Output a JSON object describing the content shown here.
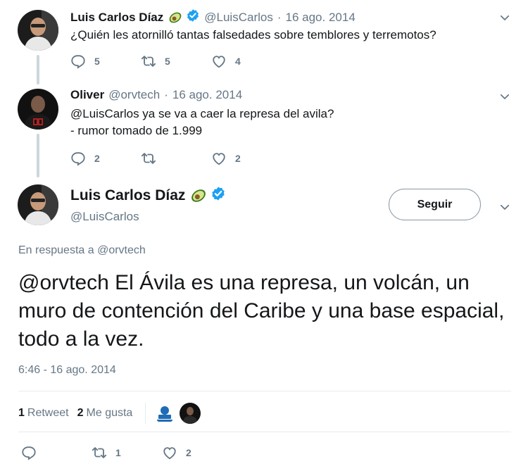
{
  "tweets": [
    {
      "name": "Luis Carlos Díaz",
      "handle": "@LuisCarlos",
      "separator": "·",
      "date": "16 ago. 2014",
      "text": "¿Quién les atornilló tantas falsedades sobre temblores y terremotos?",
      "replies": "5",
      "retweets": "5",
      "likes": "4"
    },
    {
      "name": "Oliver",
      "handle": "@orvtech",
      "separator": "·",
      "date": "16 ago. 2014",
      "text_line1": "@LuisCarlos ya se va a caer la represa del avila?",
      "text_line2": "- rumor tomado de 1.999",
      "replies": "2",
      "retweets": "",
      "likes": "2"
    }
  ],
  "main": {
    "name": "Luis Carlos Díaz",
    "handle": "@LuisCarlos",
    "follow_label": "Seguir",
    "reply_to_prefix": "En respuesta a",
    "reply_to_handle": "@orvtech",
    "text": "@orvtech El Ávila es una represa, un volcán, un muro de contención del Caribe y una base espacial, todo a la vez.",
    "timestamp": "6:46 - 16 ago. 2014",
    "retweet_count": "1",
    "retweet_label": "Retweet",
    "like_count": "2",
    "like_label": "Me gusta",
    "action_replies": "",
    "action_retweets": "1",
    "action_likes": "2"
  },
  "colors": {
    "text": "#14171a",
    "muted": "#657786",
    "verified": "#1da1f2",
    "border": "#e6ecf0"
  },
  "icons": [
    "reply-icon",
    "retweet-icon",
    "like-icon",
    "chevron-down-icon",
    "verified-icon",
    "avocado-emoji"
  ]
}
